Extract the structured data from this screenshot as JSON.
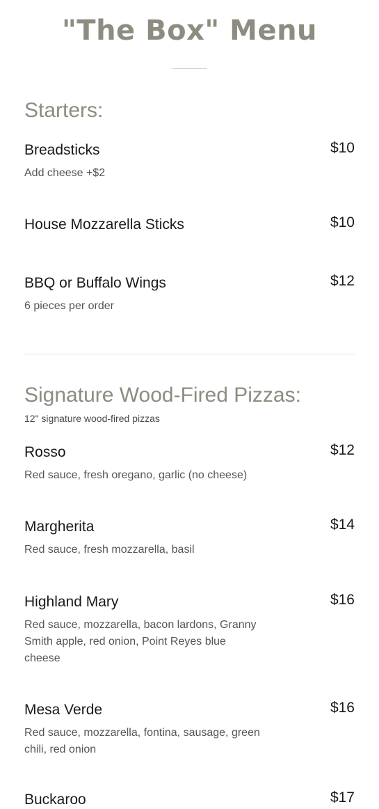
{
  "menu": {
    "title": "\"The Box\" Menu"
  },
  "sections": [
    {
      "heading": "Starters:",
      "subtitle": "",
      "items": [
        {
          "name": "Breadsticks",
          "price": "$10",
          "description": "Add cheese +$2"
        },
        {
          "name": "House Mozzarella Sticks",
          "price": "$10",
          "description": ""
        },
        {
          "name": "BBQ or Buffalo Wings",
          "price": "$12",
          "description": "6 pieces per order"
        }
      ]
    },
    {
      "heading": "Signature Wood-Fired Pizzas:",
      "subtitle": "12\" signature wood-fired pizzas",
      "items": [
        {
          "name": "Rosso",
          "price": "$12",
          "description": "Red sauce, fresh oregano, garlic (no cheese)"
        },
        {
          "name": "Margherita",
          "price": "$14",
          "description": "Red sauce, fresh mozzarella, basil"
        },
        {
          "name": "Highland Mary",
          "price": "$16",
          "description": "Red sauce, mozzarella, bacon lardons, Granny Smith apple, red onion, Point Reyes blue cheese"
        },
        {
          "name": "Mesa Verde",
          "price": "$16",
          "description": "Red sauce, mozzarella, fontina, sausage, green chili, red onion"
        },
        {
          "name": "Buckaroo",
          "price": "$17",
          "description": ""
        }
      ]
    }
  ]
}
